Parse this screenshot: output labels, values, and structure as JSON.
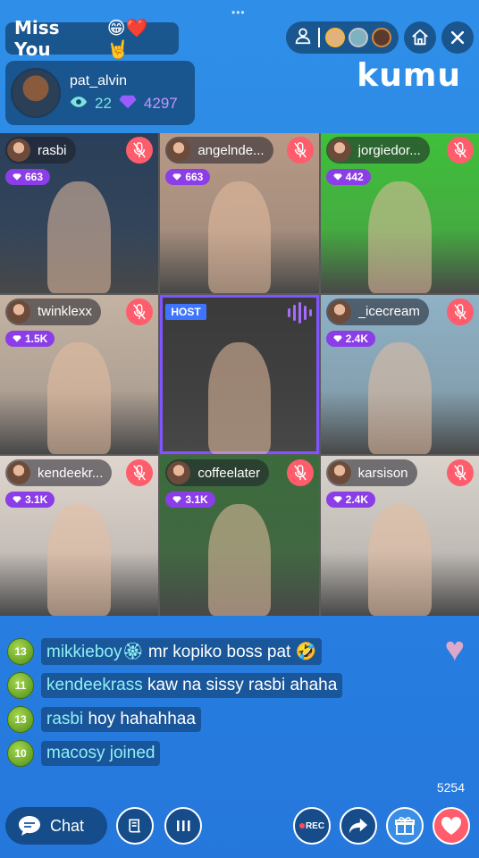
{
  "header": {
    "handle_glyph": "•••",
    "title": "Miss You",
    "title_emojis": "😁❤️🤘",
    "brand": "kumu"
  },
  "host": {
    "name": "pat_alvin",
    "viewers": "22",
    "diamonds": "4297"
  },
  "tiles": [
    {
      "user": "rasbi",
      "gems": "663",
      "bg": "#2a3f5a"
    },
    {
      "user": "angelnde...",
      "gems": "663",
      "bg": "#b89a86"
    },
    {
      "user": "jorgiedor...",
      "gems": "442",
      "bg": "#3fc03a"
    },
    {
      "user": "twinklexx",
      "gems": "1.5K",
      "bg": "#c4b3a3"
    },
    {
      "user": "",
      "gems": "",
      "bg": "#3b3a3a",
      "host_label": "HOST"
    },
    {
      "user": "_icecream",
      "gems": "2.4K",
      "bg": "#8fb2c6"
    },
    {
      "user": "kendeekr...",
      "gems": "3.1K",
      "bg": "#e0d6cf"
    },
    {
      "user": "coffeelater",
      "gems": "3.1K",
      "bg": "#3b6b3c"
    },
    {
      "user": "karsison",
      "gems": "2.4K",
      "bg": "#d9d3cc"
    }
  ],
  "chat": [
    {
      "level": "13",
      "user": "mikkieboy🏵",
      "msg": "mr kopiko boss pat 🤣"
    },
    {
      "level": "11",
      "user": "kendeekrass",
      "msg": "kaw na sissy rasbi ahaha"
    },
    {
      "level": "13",
      "user": "rasbi",
      "msg": "hoy hahahhaa"
    },
    {
      "level": "10",
      "user": "macosy joined",
      "msg": ""
    }
  ],
  "counter": "5254",
  "bottom": {
    "chat_label": "Chat",
    "rec_label": "REC"
  },
  "colors": {
    "accent": "#2f8fe8",
    "mute": "#ff5c6c",
    "gem": "#8b3ee8",
    "host_border": "#7e55ff"
  }
}
